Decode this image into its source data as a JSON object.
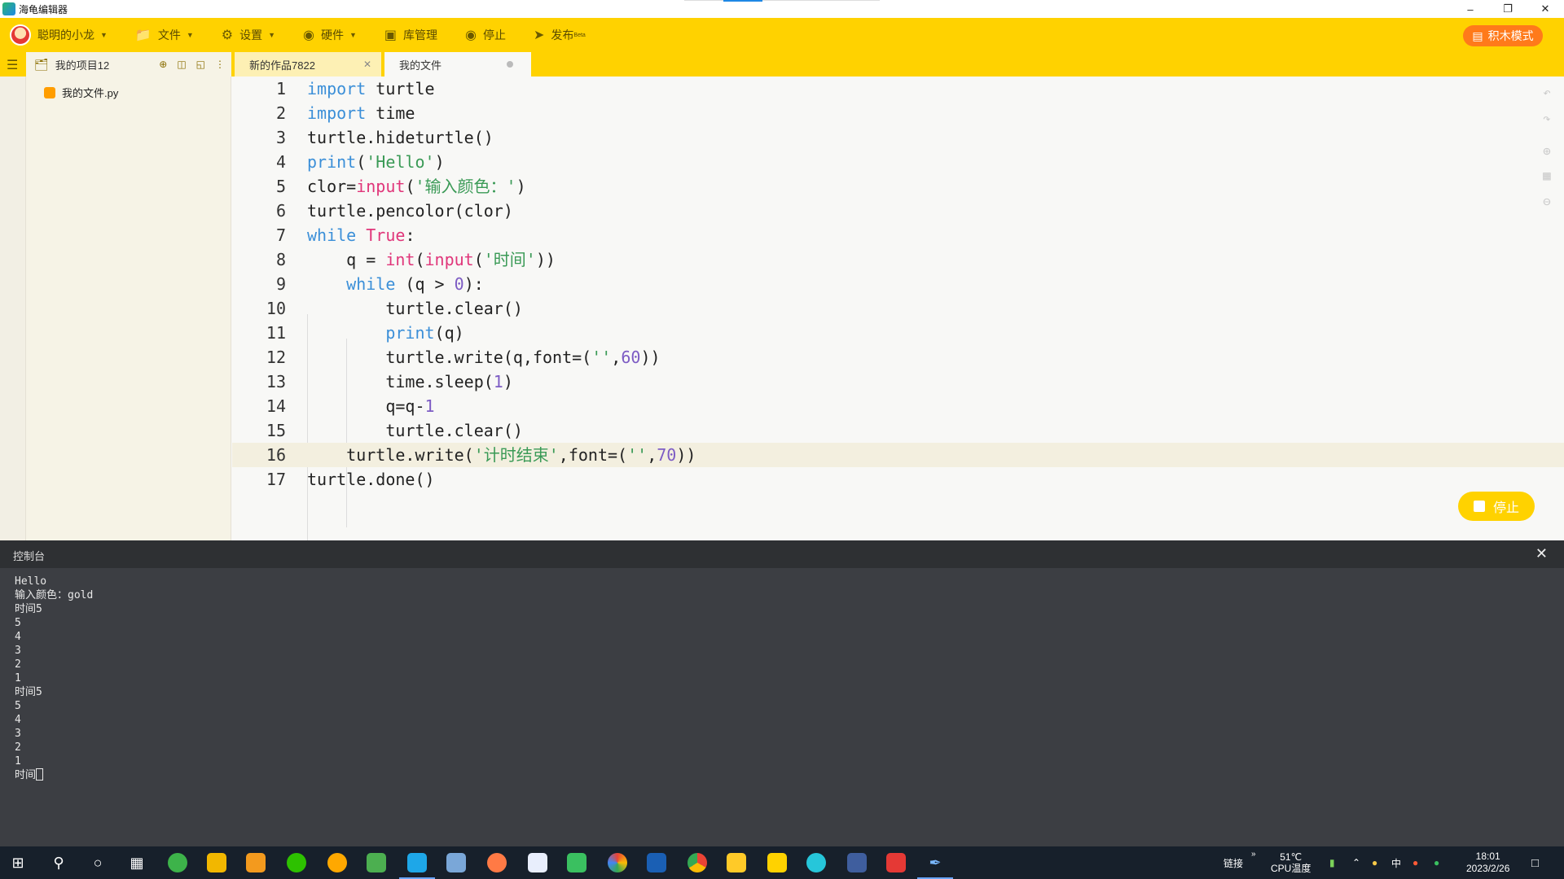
{
  "window": {
    "title": "海龟编辑器",
    "min_icon": "minimize-icon",
    "restore_icon": "restore-icon",
    "close_icon": "close-icon"
  },
  "toolbar": {
    "user": "聪明的小龙",
    "file": "文件",
    "settings": "设置",
    "hardware": "硬件",
    "library": "库管理",
    "stop": "停止",
    "publish": "发布",
    "publish_sup": "Beta",
    "blocks_mode": "积木模式"
  },
  "project": {
    "name": "我的项目12",
    "file": "我的文件.py"
  },
  "tabs": [
    {
      "label": "新的作品7822"
    },
    {
      "label": "我的文件"
    }
  ],
  "code": {
    "line_numbers": [
      "1",
      "2",
      "3",
      "4",
      "5",
      "6",
      "7",
      "8",
      "9",
      "10",
      "11",
      "12",
      "13",
      "14",
      "15",
      "16",
      "17"
    ]
  },
  "stop_button": "停止",
  "console": {
    "title": "控制台",
    "lines": [
      "Hello",
      "输入颜色：gold",
      "时间5",
      "5",
      "4",
      "3",
      "2",
      "1",
      "时间5",
      "5",
      "4",
      "3",
      "2",
      "1",
      "时间"
    ]
  },
  "taskbar": {
    "link": "链接",
    "temp": "51℃",
    "temp_label": "CPU温度",
    "ime": "中",
    "time": "18:01",
    "date": "2023/2/26"
  },
  "colors": {
    "toolbar": "#ffd200",
    "blocks_btn": "#ff7a1a",
    "keyword": "#3b8fd8",
    "builtin": "#e0367a",
    "string": "#3a9a56",
    "number": "#7d5cc4"
  }
}
